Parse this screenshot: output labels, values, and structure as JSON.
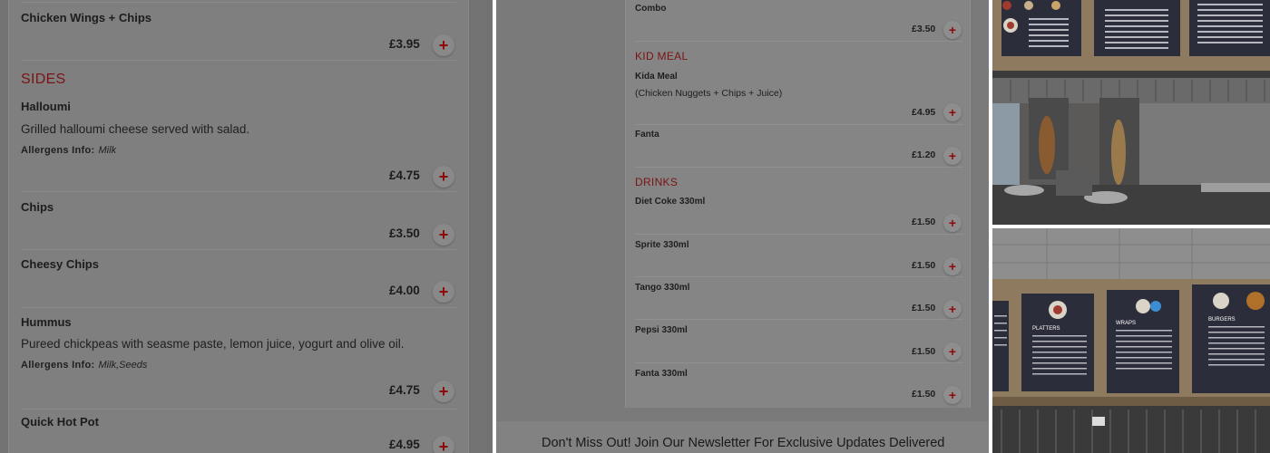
{
  "menu": {
    "item_chicken_wings": {
      "name": "Chicken Wings + Chips",
      "price": "£3.95"
    },
    "category_sides": "SIDES",
    "item_halloumi": {
      "name": "Halloumi",
      "description": "Grilled halloumi cheese served with salad.",
      "allergens_label": "Allergens Info:",
      "allergens": "Milk",
      "price": "£4.75"
    },
    "item_chips": {
      "name": "Chips",
      "price": "£3.50"
    },
    "item_cheesy_chips": {
      "name": "Cheesy Chips",
      "price": "£4.00"
    },
    "item_hummus": {
      "name": "Hummus",
      "description": "Pureed chickpeas with seasme paste, lemon juice, yogurt and olive oil.",
      "allergens_label": "Allergens Info:",
      "allergens": "Milk,Seeds",
      "price": "£4.75"
    },
    "item_quick_hot_pot": {
      "name": "Quick Hot Pot",
      "price": "£4.95"
    },
    "add_symbol": "+"
  },
  "menu2": {
    "item_combo": {
      "name": "Combo",
      "price": "£3.50"
    },
    "category_kid_meal": "KID MEAL",
    "item_kida_meal": {
      "name": "Kida Meal",
      "description": "(Chicken Nuggets + Chips + Juice)",
      "price": "£4.95"
    },
    "item_fanta": {
      "name": "Fanta",
      "price": "£1.20"
    },
    "category_drinks": "DRINKS",
    "item_diet_coke": {
      "name": "Diet Coke 330ml",
      "price": "£1.50"
    },
    "item_sprite": {
      "name": "Sprite 330ml",
      "price": "£1.50"
    },
    "item_tango": {
      "name": "Tango 330ml",
      "price": "£1.50"
    },
    "item_pepsi": {
      "name": "Pepsi 330ml",
      "price": "£1.50"
    },
    "item_fanta_330": {
      "name": "Fanta 330ml",
      "price": "£1.50"
    },
    "newsletter": "Don't Miss Out! Join Our Newsletter For Exclusive Updates Delivered"
  },
  "photos": {
    "signs": {
      "platters": "PLATTERS",
      "wraps": "WRAPS",
      "burgers": "BURGERS"
    }
  },
  "colors": {
    "overlay_grey": "#7f7f7f",
    "category_red": "#7a1414",
    "add_red": "#8c0a0a"
  }
}
